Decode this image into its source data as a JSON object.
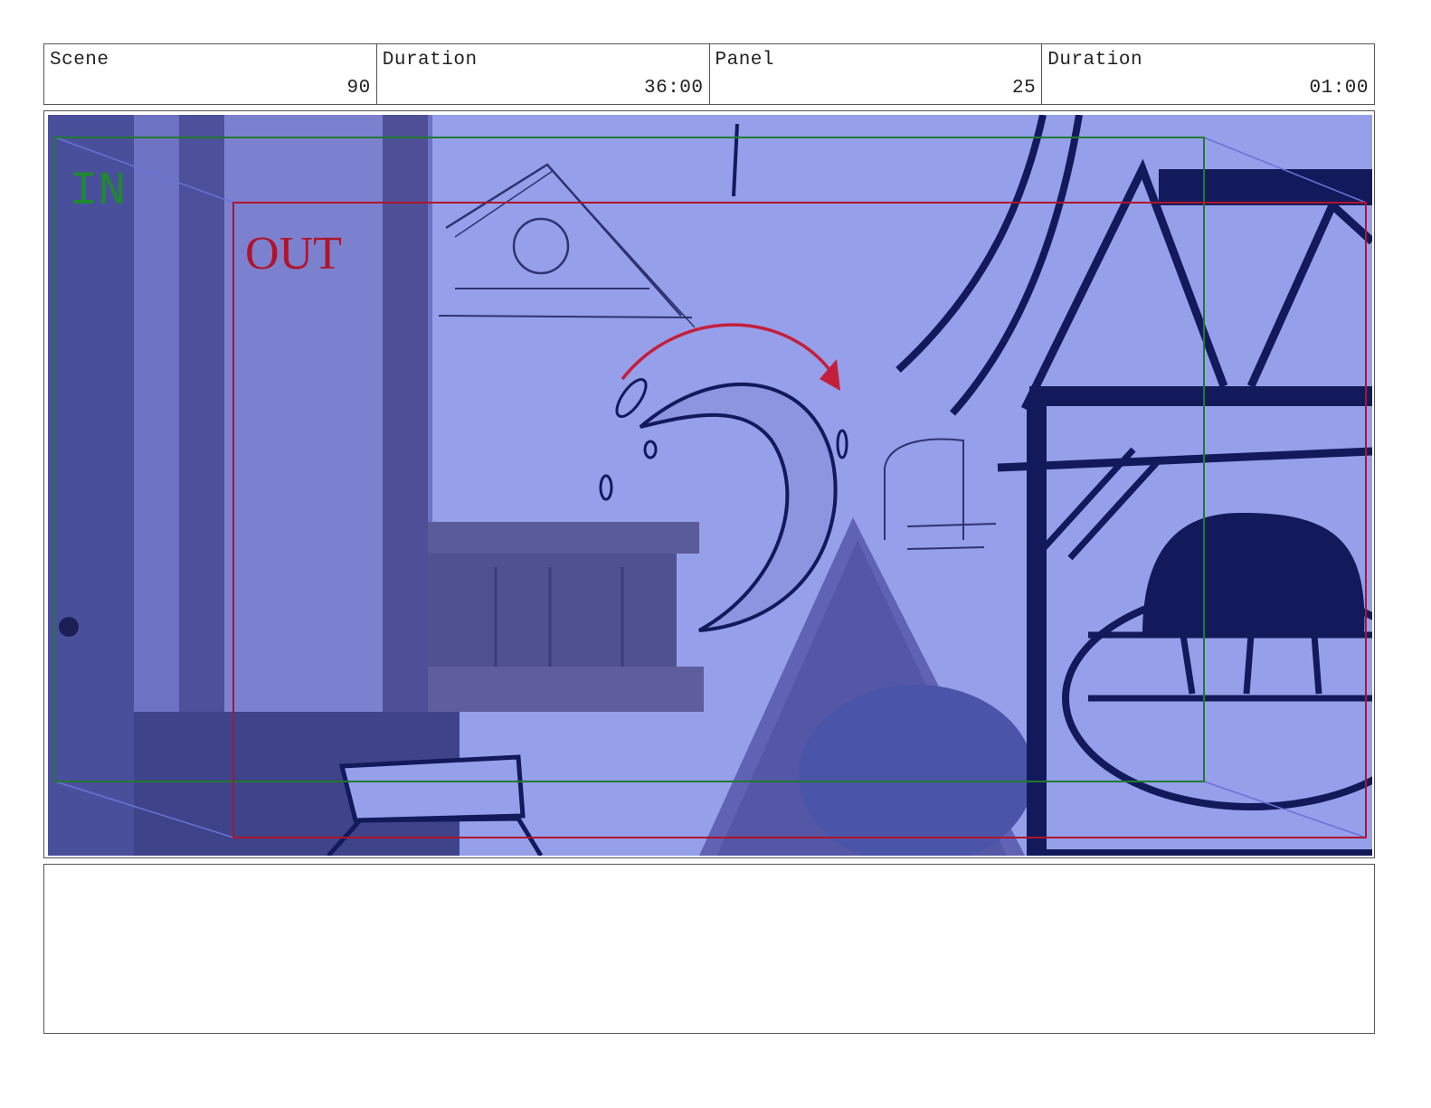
{
  "header": {
    "scene_label": "Scene",
    "scene_value": "90",
    "duration_label": "Duration",
    "duration_value": "36:00",
    "panel_label": "Panel",
    "panel_value": "25",
    "panel_duration_label": "Duration",
    "panel_duration_value": "01:00"
  },
  "panel": {
    "in_label": "IN",
    "out_label": "OUT"
  },
  "notes": {
    "text": ""
  },
  "colors": {
    "tint": "#8f97e6",
    "ink": "#121a5c",
    "in_frame": "#1f8a2f",
    "out_frame": "#b0142a"
  }
}
